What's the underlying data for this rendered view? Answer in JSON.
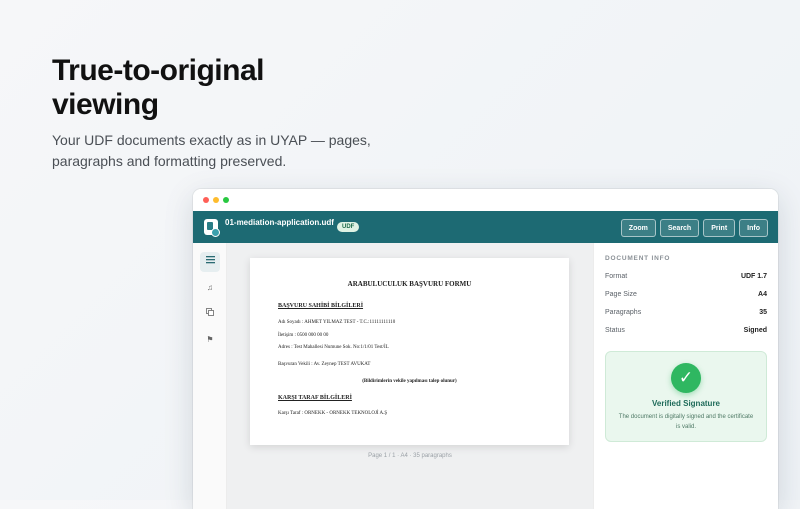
{
  "hero": {
    "title": "True-to-original viewing",
    "subtitle": "Your UDF documents exactly as in UYAP — pages, paragraphs and formatting preserved."
  },
  "window": {
    "filename": "01-mediation-application.udf",
    "file_badge": "UDF",
    "toolbar_buttons": [
      "Zoom",
      "Search",
      "Print",
      "Info"
    ],
    "rail_icons": [
      "list-icon",
      "music-note-icon",
      "copy-icon",
      "flag-icon"
    ]
  },
  "document": {
    "title": "ARABULUCULUK BAŞVURU FORMU",
    "section1": "BAŞVURU SAHİBİ BİLGİLERİ",
    "name_line": "Adı Soyadı : AHMET YILMAZ TEST - T.C.:11111111110",
    "phone_line": "İletişim : 0500 000 00 00",
    "address_line": "Adres : Test Mahallesi Numune Sok. No:1/1/01 Test/İL",
    "agent_line": "Başvuran Vekili : Av. Zeynep TEST AVUKAT",
    "notice_line": "(Bildirimlerin vekile yapılması talep olunur)",
    "section2": "KARŞI TARAF BİLGİLERİ",
    "counter_line": "Karşı Taraf : ORNEKK - ORNEKK TEKNOLOJİ A.Ş",
    "page_footer": "Page 1 / 1 · A4 · 35 paragraphs"
  },
  "info": {
    "heading": "DOCUMENT INFO",
    "rows": [
      {
        "key": "Format",
        "value": "UDF 1.7"
      },
      {
        "key": "Page Size",
        "value": "A4"
      },
      {
        "key": "Paragraphs",
        "value": "35"
      },
      {
        "key": "Status",
        "value": "Signed"
      }
    ],
    "verified_title": "Verified Signature",
    "verified_text": "The document is digitally signed and the certificate is valid."
  },
  "colors": {
    "toolbar": "#1d6a73",
    "verified_bg": "#eaf7ee",
    "check": "#2fb761"
  }
}
